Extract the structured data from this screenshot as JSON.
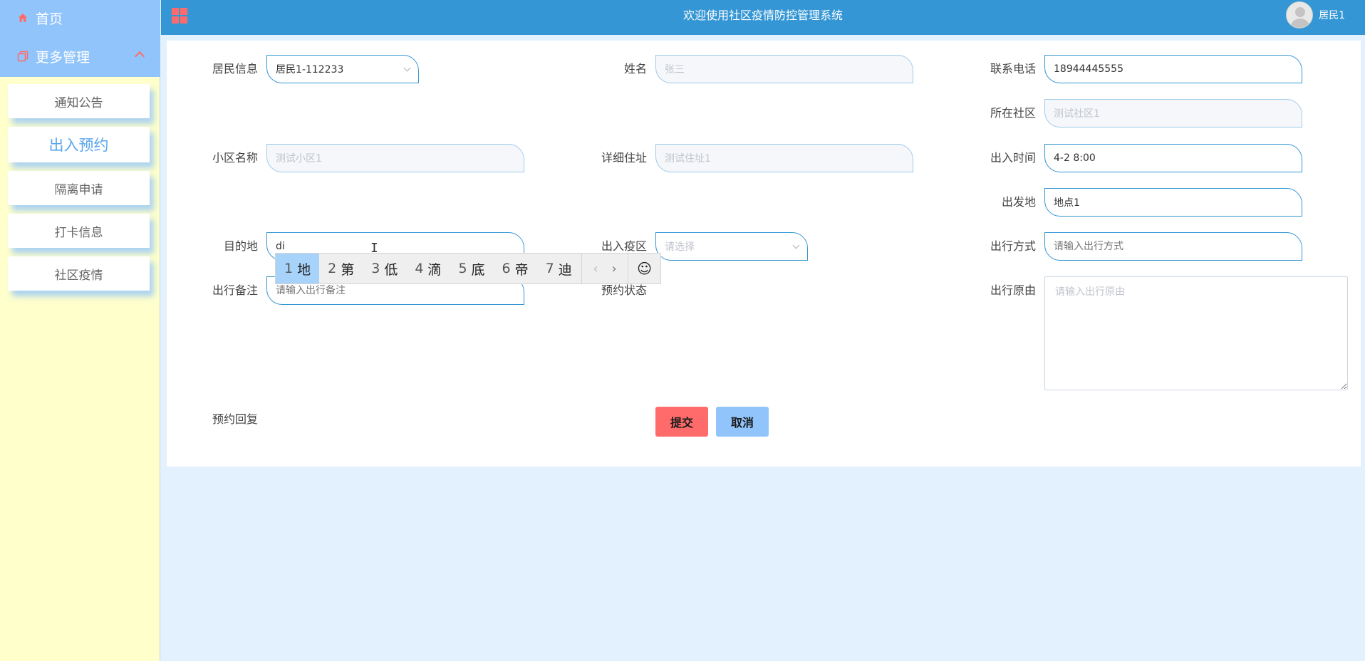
{
  "sidebar": {
    "home_label": "首页",
    "more_label": "更多管理",
    "items": [
      {
        "label": "通知公告",
        "active": false
      },
      {
        "label": "出入预约",
        "active": true
      },
      {
        "label": "隔离申请",
        "active": false
      },
      {
        "label": "打卡信息",
        "active": false
      },
      {
        "label": "社区疫情",
        "active": false
      }
    ]
  },
  "header": {
    "title": "欢迎使用社区疫情防控管理系统",
    "username": "居民1"
  },
  "form": {
    "resident_info_label": "居民信息",
    "resident_info_value": "居民1-112233",
    "name_label": "姓名",
    "name_value": "张三",
    "phone_label": "联系电话",
    "phone_value": "18944445555",
    "community_label": "所在社区",
    "community_value": "测试社区1",
    "estate_label": "小区名称",
    "estate_value": "测试小区1",
    "address_label": "详细住址",
    "address_value": "测试住址1",
    "time_label": "出入时间",
    "time_value": "4-2 8:00",
    "origin_label": "出发地",
    "origin_value": "地点1",
    "destination_label": "目的地",
    "destination_value": "di",
    "zone_label": "出入疫区",
    "zone_placeholder": "请选择",
    "mode_label": "出行方式",
    "mode_placeholder": "请输入出行方式",
    "remark_label": "出行备注",
    "remark_placeholder": "请输入出行备注",
    "status_label": "预约状态",
    "reason_label": "出行原由",
    "reason_placeholder": "请输入出行原由",
    "reply_label": "预约回复",
    "submit_label": "提交",
    "cancel_label": "取消"
  },
  "ime": {
    "candidates": [
      {
        "num": "1",
        "char": "地"
      },
      {
        "num": "2",
        "char": "第"
      },
      {
        "num": "3",
        "char": "低"
      },
      {
        "num": "4",
        "char": "滴"
      },
      {
        "num": "5",
        "char": "底"
      },
      {
        "num": "6",
        "char": "帝"
      },
      {
        "num": "7",
        "char": "迪"
      }
    ],
    "prev": "‹",
    "next": "›",
    "emoji": "☺"
  },
  "colors": {
    "header": "#3496d4",
    "sidebar_head": "#91c4fb",
    "sidebar_bg": "#ffffcc",
    "accent_red": "#ff6b6b",
    "page_bg": "#e3f0fd"
  }
}
